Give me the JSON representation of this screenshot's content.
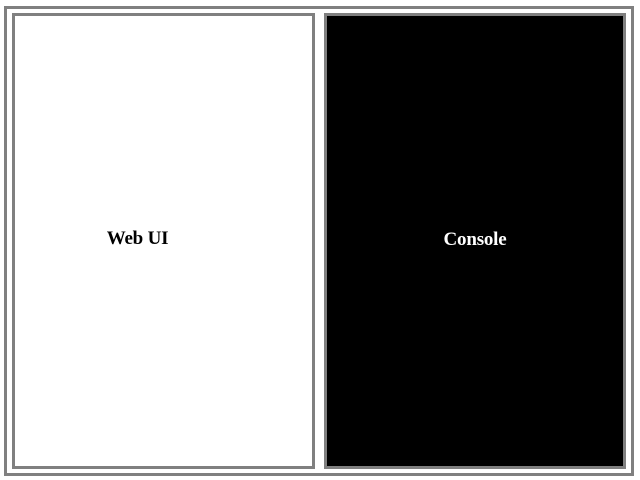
{
  "panes": {
    "left": {
      "label": "Web UI",
      "background": "#ffffff",
      "text_color": "#000000"
    },
    "right": {
      "label": "Console",
      "background": "#000000",
      "text_color": "#ffffff"
    }
  },
  "border_color": "#808080"
}
